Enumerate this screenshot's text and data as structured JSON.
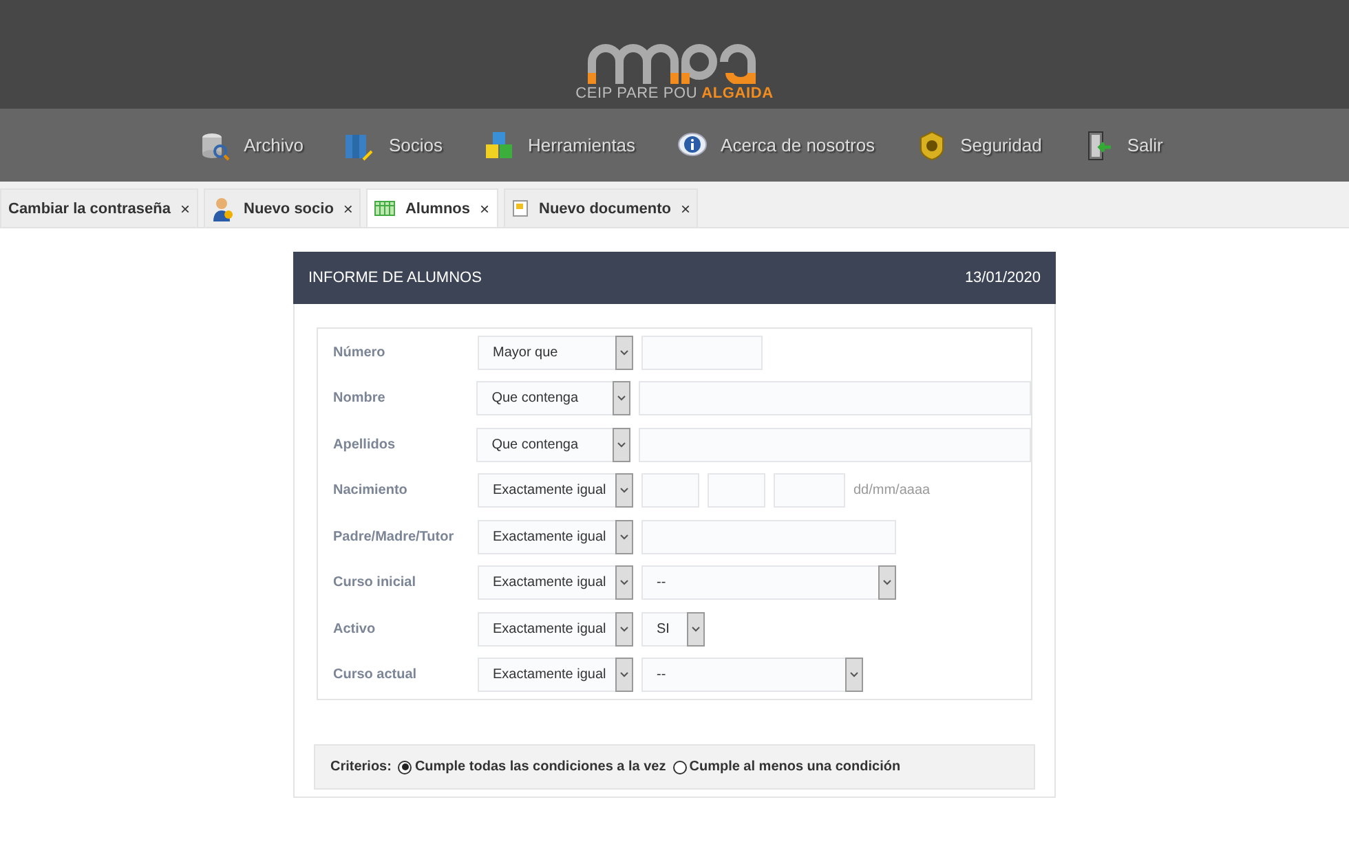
{
  "logo": {
    "school": "CEIP PARE POU",
    "town": "ALGAIDA"
  },
  "menu": [
    {
      "label": "Archivo"
    },
    {
      "label": "Socios"
    },
    {
      "label": "Herramientas"
    },
    {
      "label": "Acerca de nosotros"
    },
    {
      "label": "Seguridad"
    },
    {
      "label": "Salir"
    }
  ],
  "tabs": [
    {
      "label": "Cambiar la contraseña",
      "selected": false,
      "close": "×"
    },
    {
      "label": "Nuevo socio",
      "selected": false,
      "close": "×"
    },
    {
      "label": "Alumnos",
      "selected": true,
      "close": "×"
    },
    {
      "label": "Nuevo documento",
      "selected": false,
      "close": "×"
    }
  ],
  "report": {
    "title": "INFORME DE ALUMNOS",
    "date": "13/01/2020",
    "rows": [
      {
        "label": "Número",
        "operator": "Mayor que",
        "field": {
          "kind": "short-text"
        }
      },
      {
        "label": "Nombre",
        "operator": "Que contenga",
        "field": {
          "kind": "long-text"
        }
      },
      {
        "label": "Apellidos",
        "operator": "Que contenga",
        "field": {
          "kind": "long-text"
        }
      },
      {
        "label": "Nacimiento",
        "operator": "Exactamente igual",
        "field": {
          "kind": "date",
          "hint": "dd/mm/aaaa"
        }
      },
      {
        "label": "Padre/Madre/Tutor",
        "operator": "Exactamente igual",
        "field": {
          "kind": "medium-text"
        }
      },
      {
        "label": "Curso inicial",
        "operator": "Exactamente igual",
        "field": {
          "kind": "wide-select",
          "value": "--"
        }
      },
      {
        "label": "Activo",
        "operator": "Exactamente igual",
        "field": {
          "kind": "small-select",
          "value": "SI"
        }
      },
      {
        "label": "Curso actual",
        "operator": "Exactamente igual",
        "field": {
          "kind": "mid-select",
          "value": "--"
        }
      }
    ],
    "criteria": {
      "label": "Criterios:",
      "options": [
        {
          "label": "Cumple todas las condiciones a la vez",
          "selected": true
        },
        {
          "label": "Cumple al menos una condición",
          "selected": false
        }
      ]
    }
  }
}
